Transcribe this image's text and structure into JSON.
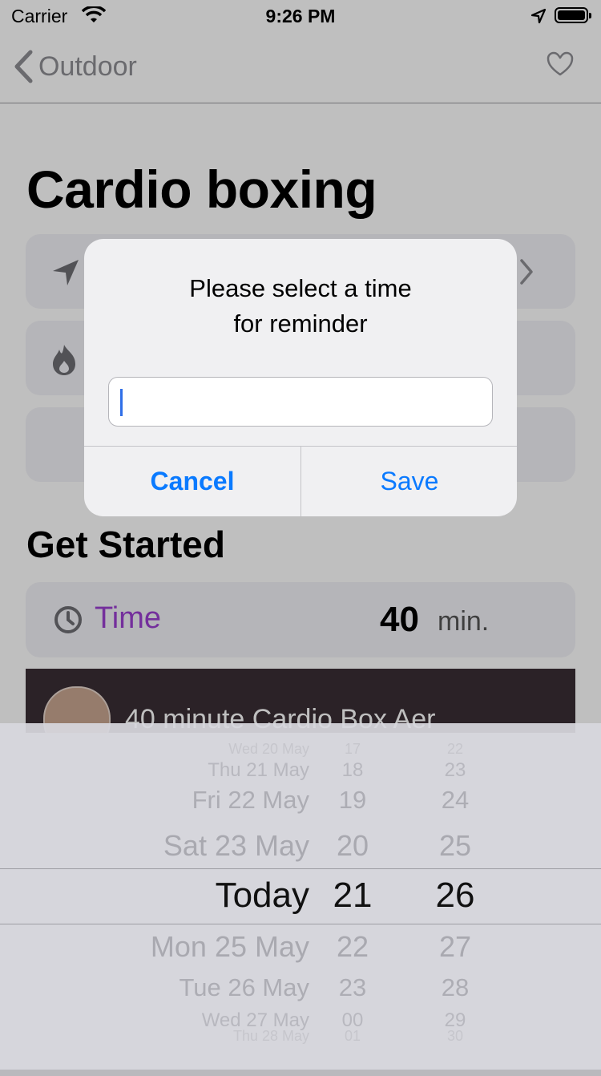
{
  "status_bar": {
    "carrier": "Carrier",
    "time": "9:26 PM"
  },
  "nav": {
    "back_label": "Outdoor"
  },
  "page": {
    "title": "Cardio boxing",
    "section_title": "Get Started",
    "time_card": {
      "label": "Time",
      "value": "40",
      "unit": "min."
    },
    "video_title": "40 minute Cardio Box Aer"
  },
  "alert": {
    "message_line1": "Please select a time",
    "message_line2": "for reminder",
    "input_value": "",
    "cancel_label": "Cancel",
    "save_label": "Save"
  },
  "picker": {
    "rows": [
      {
        "day": "Wed 20 May",
        "hour": "17",
        "minute": "22"
      },
      {
        "day": "Thu 21 May",
        "hour": "18",
        "minute": "23"
      },
      {
        "day": "Fri 22 May",
        "hour": "19",
        "minute": "24"
      },
      {
        "day": "Sat 23 May",
        "hour": "20",
        "minute": "25"
      },
      {
        "day": "Today",
        "hour": "21",
        "minute": "26"
      },
      {
        "day": "Mon 25 May",
        "hour": "22",
        "minute": "27"
      },
      {
        "day": "Tue 26 May",
        "hour": "23",
        "minute": "28"
      },
      {
        "day": "Wed 27 May",
        "hour": "00",
        "minute": "29"
      },
      {
        "day": "Thu 28 May",
        "hour": "01",
        "minute": "30"
      }
    ]
  },
  "colors": {
    "accent": "#0a7aff",
    "time_label": "#9b3fd1"
  }
}
